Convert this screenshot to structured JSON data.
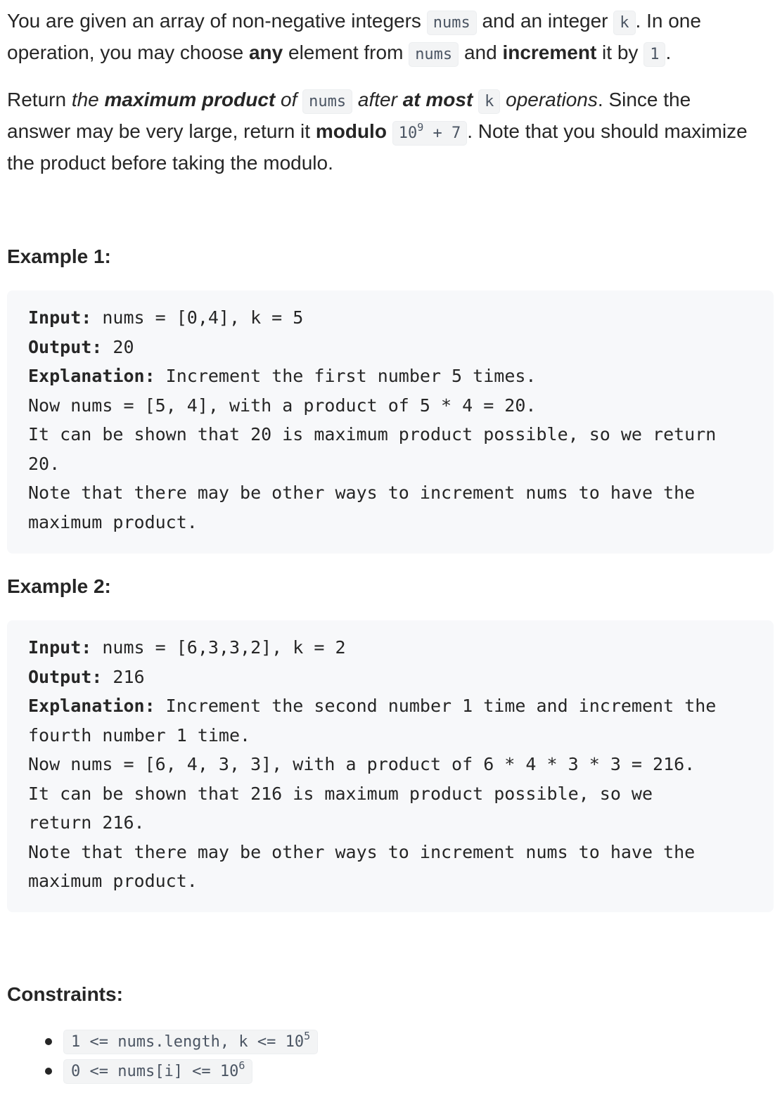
{
  "intro": {
    "p1": {
      "t1": "You are given an array of non-negative integers ",
      "c1": "nums",
      "t2": " and an integer ",
      "c2": "k",
      "t3": ". In one operation, you may choose ",
      "b1": "any",
      "t4": " element from ",
      "c3": "nums",
      "t5": " and ",
      "b2": "increment",
      "t6": " it by ",
      "c4": "1",
      "t7": "."
    },
    "p2": {
      "t1": "Return ",
      "i1": "the ",
      "bi1": "maximum product",
      "i2": " of ",
      "c1": "nums",
      "i3": " after ",
      "bi2": "at most",
      "c2": "k",
      "i4": " operations",
      "t2": ". Since the answer may be very large, return it ",
      "b1": "modulo",
      "c3_base": "10",
      "c3_exp": "9",
      "c3_rest": " + 7",
      "t3": ". Note that you should maximize the product before taking the modulo."
    }
  },
  "example1": {
    "heading": "Example 1:",
    "input_label": "Input:",
    "input_value": " nums = [0,4], k = 5",
    "output_label": "Output:",
    "output_value": " 20",
    "explanation_label": "Explanation:",
    "explanation_line1": " Increment the first number 5 times.",
    "lines": [
      "Now nums = [5, 4], with a product of 5 * 4 = 20.",
      "It can be shown that 20 is maximum product possible, so we return",
      "20.",
      "Note that there may be other ways to increment nums to have the",
      "maximum product."
    ]
  },
  "example2": {
    "heading": "Example 2:",
    "input_label": "Input:",
    "input_value": " nums = [6,3,3,2], k = 2",
    "output_label": "Output:",
    "output_value": " 216",
    "explanation_label": "Explanation:",
    "explanation_line1": " Increment the second number 1 time and increment the",
    "lines": [
      "fourth number 1 time.",
      "Now nums = [6, 4, 3, 3], with a product of 6 * 4 * 3 * 3 = 216.",
      "It can be shown that 216 is maximum product possible, so we",
      "return 216.",
      "Note that there may be other ways to increment nums to have the",
      "maximum product."
    ]
  },
  "constraints": {
    "heading": "Constraints:",
    "items": [
      {
        "text": "1 <= nums.length, k <= 10",
        "exp": "5"
      },
      {
        "text": "0 <= nums[i] <= 10",
        "exp": "6"
      }
    ]
  }
}
